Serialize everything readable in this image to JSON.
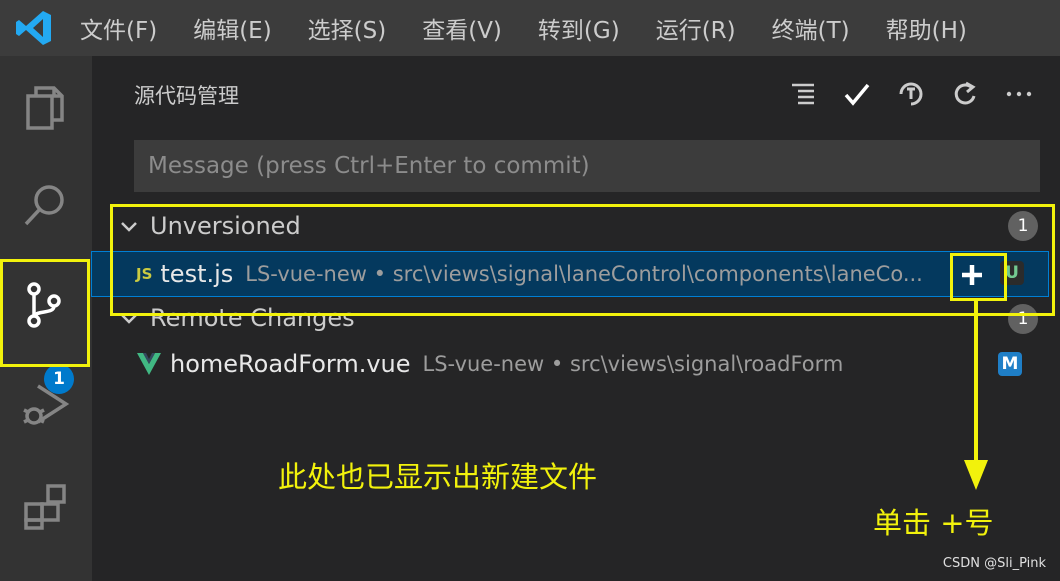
{
  "menu": [
    "文件(F)",
    "编辑(E)",
    "选择(S)",
    "查看(V)",
    "转到(G)",
    "运行(R)",
    "终端(T)",
    "帮助(H)"
  ],
  "activity_bar": {
    "scm_badge": "1"
  },
  "scm": {
    "title": "源代码管理",
    "commit_placeholder": "Message (press Ctrl+Enter to commit)",
    "groups": [
      {
        "label": "Unversioned",
        "count": "1",
        "files": [
          {
            "icon_text": "JS",
            "name": "test.js",
            "path": "LS-vue-new • src\\views\\signal\\laneControl\\components\\laneCo...",
            "status": "U"
          }
        ]
      },
      {
        "label": "Remote Changes",
        "count": "1",
        "files": [
          {
            "name": "homeRoadForm.vue",
            "path": "LS-vue-new • src\\views\\signal\\roadForm",
            "status": "M"
          }
        ]
      }
    ]
  },
  "annotations": {
    "note1": "此处也已显示出新建文件",
    "note2": "单击 +号"
  },
  "watermark": "CSDN @Sli_Pink",
  "colors": {
    "highlight": "#f2f20c",
    "accent": "#007acc",
    "js": "#cbcb41",
    "vue": "#41b883"
  }
}
